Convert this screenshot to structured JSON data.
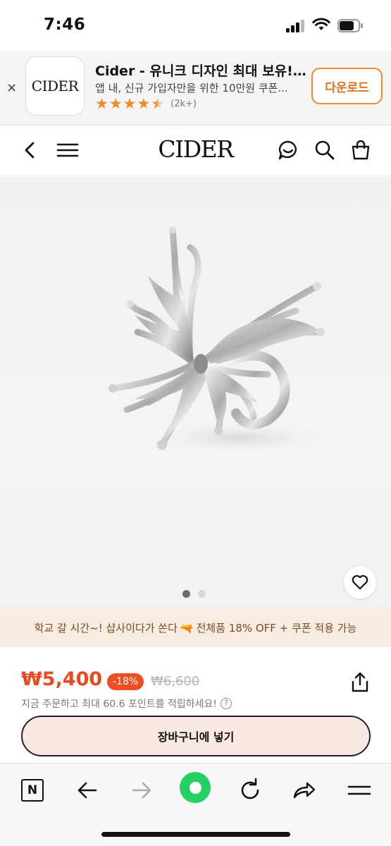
{
  "status": {
    "time": "7:46"
  },
  "app_banner": {
    "close_label": "×",
    "logo_text": "CIDER",
    "title": "Cider - 유니크 디자인 최대 보유!...",
    "subtitle": "앱 내, 신규 가입자만을 위한 10만원 쿠폰...",
    "rating": 4.5,
    "rating_count": "(2k+)",
    "download_label": "다운로드",
    "accent_color": "#ef8a2a"
  },
  "header": {
    "logo_text": "CIDER",
    "icons": [
      "back-icon",
      "menu-icon",
      "chat-icon",
      "search-icon",
      "bag-icon"
    ]
  },
  "product": {
    "image_subject": "silver butterfly ring",
    "carousel_total": 2,
    "carousel_active": 1,
    "wishlist_icon": "heart-icon"
  },
  "promo": {
    "text_before": "학교 갈 시간~! 샵사이다가 쏜다",
    "text_after": "전체품 18% OFF + 쿠폰 적용 가능",
    "emoji": "🔫"
  },
  "pricing": {
    "price": "₩5,400",
    "discount": "-18%",
    "original_price": "₩6,600",
    "points_text": "지금 주문하고 최대 60.6 포인트를 적립하세요!",
    "help_label": "?",
    "price_color": "#e8491d"
  },
  "actions": {
    "add_to_cart": "장바구니에 넣기"
  },
  "browser_toolbar": {
    "items": [
      "naver-icon",
      "back-arrow-icon",
      "forward-arrow-icon",
      "home-green-icon",
      "refresh-icon",
      "share-arrow-icon",
      "hamburger-icon"
    ],
    "naver_letter": "N"
  }
}
